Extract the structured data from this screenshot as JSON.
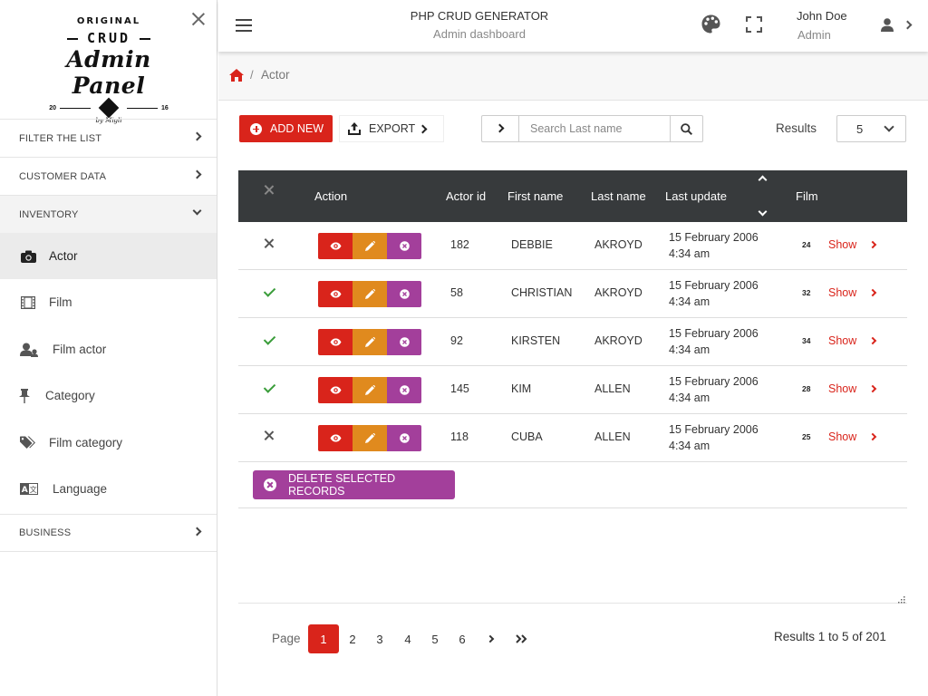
{
  "sidebar": {
    "logo": {
      "line1": "ORIGINAL",
      "line2": "CRUD",
      "line3": "Admin Panel",
      "year_left": "20",
      "year_right": "16",
      "byline": "by Migli"
    },
    "sections": [
      {
        "label": "FILTER THE LIST",
        "expanded": false
      },
      {
        "label": "CUSTOMER DATA",
        "expanded": false
      },
      {
        "label": "INVENTORY",
        "expanded": true
      },
      {
        "label": "BUSINESS",
        "expanded": false
      }
    ],
    "items": [
      {
        "label": "Actor",
        "icon": "camera-icon",
        "active": true
      },
      {
        "label": "Film",
        "icon": "film-icon",
        "active": false
      },
      {
        "label": "Film actor",
        "icon": "users-icon",
        "active": false
      },
      {
        "label": "Category",
        "icon": "pin-icon",
        "active": false
      },
      {
        "label": "Film category",
        "icon": "tags-icon",
        "active": false
      },
      {
        "label": "Language",
        "icon": "language-icon",
        "active": false
      }
    ]
  },
  "header": {
    "title": "PHP CRUD GENERATOR",
    "subtitle": "Admin dashboard",
    "user_name": "John Doe",
    "user_role": "Admin"
  },
  "breadcrumb": {
    "current": "Actor",
    "separator": "/"
  },
  "toolbar": {
    "add_new_label": "ADD NEW",
    "export_label": "EXPORT",
    "search_placeholder": "Search Last name",
    "results_label": "Results",
    "results_per_page": "5"
  },
  "table": {
    "headers": {
      "action": "Action",
      "actor_id": "Actor id",
      "first_name": "First name",
      "last_name": "Last name",
      "last_update": "Last update",
      "film": "Film"
    },
    "rows": [
      {
        "selected": false,
        "actor_id": "182",
        "first_name": "DEBBIE",
        "last_name": "AKROYD",
        "update_date": "15 February 2006",
        "update_time": "4:34 am",
        "film_count": "24",
        "film_link": "Show"
      },
      {
        "selected": true,
        "actor_id": "58",
        "first_name": "CHRISTIAN",
        "last_name": "AKROYD",
        "update_date": "15 February 2006",
        "update_time": "4:34 am",
        "film_count": "32",
        "film_link": "Show"
      },
      {
        "selected": true,
        "actor_id": "92",
        "first_name": "KIRSTEN",
        "last_name": "AKROYD",
        "update_date": "15 February 2006",
        "update_time": "4:34 am",
        "film_count": "34",
        "film_link": "Show"
      },
      {
        "selected": true,
        "actor_id": "145",
        "first_name": "KIM",
        "last_name": "ALLEN",
        "update_date": "15 February 2006",
        "update_time": "4:34 am",
        "film_count": "28",
        "film_link": "Show"
      },
      {
        "selected": false,
        "actor_id": "118",
        "first_name": "CUBA",
        "last_name": "ALLEN",
        "update_date": "15 February 2006",
        "update_time": "4:34 am",
        "film_count": "25",
        "film_link": "Show"
      }
    ],
    "delete_selected_label": "DELETE SELECTED RECORDS"
  },
  "pagination": {
    "label": "Page",
    "pages": [
      "1",
      "2",
      "3",
      "4",
      "5",
      "6"
    ],
    "current": "1",
    "summary": "Results 1 to 5 of 201"
  },
  "colors": {
    "primary": "#d9241b",
    "edit": "#e08a1e",
    "delete": "#a33f9b",
    "table_header": "#373a3c",
    "check": "#3a9d3a"
  }
}
